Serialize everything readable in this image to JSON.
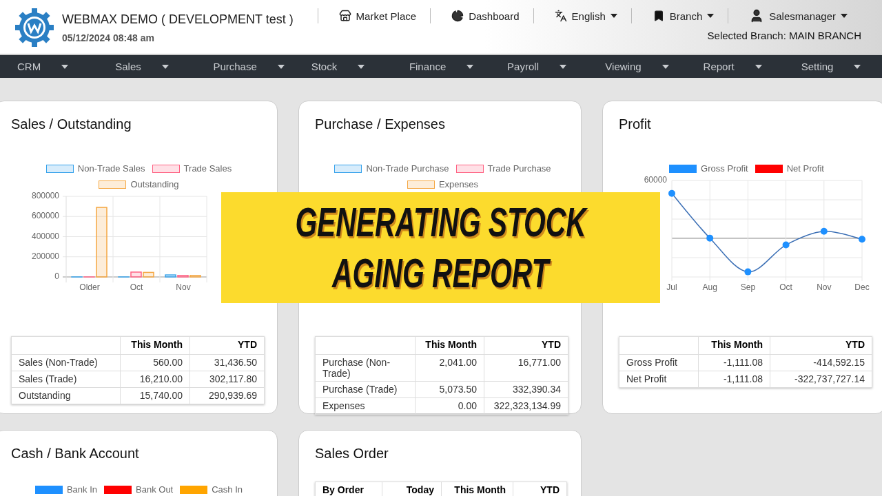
{
  "header": {
    "title": "WEBMAX DEMO ( DEVELOPMENT test )",
    "datetime": "05/12/2024 08:48 am",
    "links": [
      {
        "kind": "store",
        "label": "Market Place"
      },
      {
        "kind": "dashboard",
        "label": "Dashboard"
      },
      {
        "kind": "language",
        "label": "English",
        "dropdown": true
      },
      {
        "kind": "branch",
        "label": "Branch",
        "dropdown": true
      },
      {
        "kind": "user",
        "label": "Salesmanager",
        "dropdown": true
      }
    ],
    "selected_branch": "Selected Branch: MAIN BRANCH"
  },
  "nav": [
    "CRM",
    "Sales",
    "Purchase",
    "Stock",
    "Finance",
    "Payroll",
    "Viewing",
    "Report",
    "Setting"
  ],
  "cards": [
    {
      "title": "Sales / Outstanding",
      "chart_data": {
        "type": "bar",
        "legend": "top",
        "grid": true,
        "categories": [
          "Older",
          "Oct",
          "Nov"
        ],
        "series": [
          {
            "name": "Non-Trade Sales",
            "color": "#36a2eb",
            "values": [
              0,
              0,
              20000
            ]
          },
          {
            "name": "Trade Sales",
            "color": "#ff6384",
            "values": [
              0,
              48000,
              15000
            ]
          },
          {
            "name": "Outstanding",
            "color": "#f5a742",
            "values": [
              690000,
              45000,
              15000
            ]
          }
        ],
        "ylim": [
          0,
          800000
        ],
        "yticks": [
          0,
          200000,
          400000,
          600000,
          800000
        ]
      },
      "table": {
        "columns": [
          "This Month",
          "YTD"
        ],
        "rows": [
          {
            "label": "Sales (Non-Trade)",
            "cells": [
              "560.00",
              "31,436.50"
            ]
          },
          {
            "label": "Sales (Trade)",
            "cells": [
              "16,210.00",
              "302,117.80"
            ]
          },
          {
            "label": "Outstanding",
            "cells": [
              "15,740.00",
              "290,939.69"
            ]
          }
        ]
      }
    },
    {
      "kind": "bar_legend",
      "title": "Purchase / Expenses",
      "legend": [
        {
          "label": "Non-Trade Purchase",
          "color": "#36a2eb"
        },
        {
          "label": "Trade Purchase",
          "color": "#ff6384"
        },
        {
          "label": "Expenses",
          "color": "#f5a742"
        }
      ],
      "table": {
        "columns": [
          "This Month",
          "YTD"
        ],
        "rows": [
          {
            "label": "Purchase (Non-Trade)",
            "cells": [
              "2,041.00",
              "16,771.00"
            ]
          },
          {
            "label": "Purchase (Trade)",
            "cells": [
              "5,073.50",
              "332,390.34"
            ]
          },
          {
            "label": "Expenses",
            "cells": [
              "0.00",
              "322,323,134.99"
            ]
          }
        ]
      }
    },
    {
      "kind": "line_picture",
      "title": "Profit",
      "legend": [
        {
          "label": "Gross Profit",
          "color": "#1e90ff"
        },
        {
          "label": "Net Profit",
          "color": "#ff0000"
        }
      ],
      "y_label": "60000",
      "x_labels": [
        "Jul",
        "Aug",
        "Sep",
        "Oct",
        "Nov",
        "Dec"
      ],
      "table": {
        "columns": [
          "This Month",
          "YTD"
        ],
        "rows": [
          {
            "label": "Gross Profit",
            "cells": [
              "-1,111.08",
              "-414,592.15"
            ]
          },
          {
            "label": "Net Profit",
            "cells": [
              "-1,111.08",
              "-322,737,727.14"
            ]
          }
        ]
      }
    },
    {
      "kind": "line_legend",
      "title": "Cash / Bank Account",
      "legend": [
        {
          "label": "Bank In",
          "color": "#1e90ff"
        },
        {
          "label": "Bank Out",
          "color": "#ff0000"
        },
        {
          "label": "Cash In",
          "color": "#ffa500"
        }
      ]
    },
    {
      "kind": "table",
      "title": "Sales Order",
      "table": {
        "corner": "By Order",
        "columns": [
          "Today",
          "This Month",
          "YTD"
        ]
      }
    }
  ],
  "banner": {
    "lines": [
      "GENERATING STOCK",
      "AGING REPORT"
    ]
  }
}
